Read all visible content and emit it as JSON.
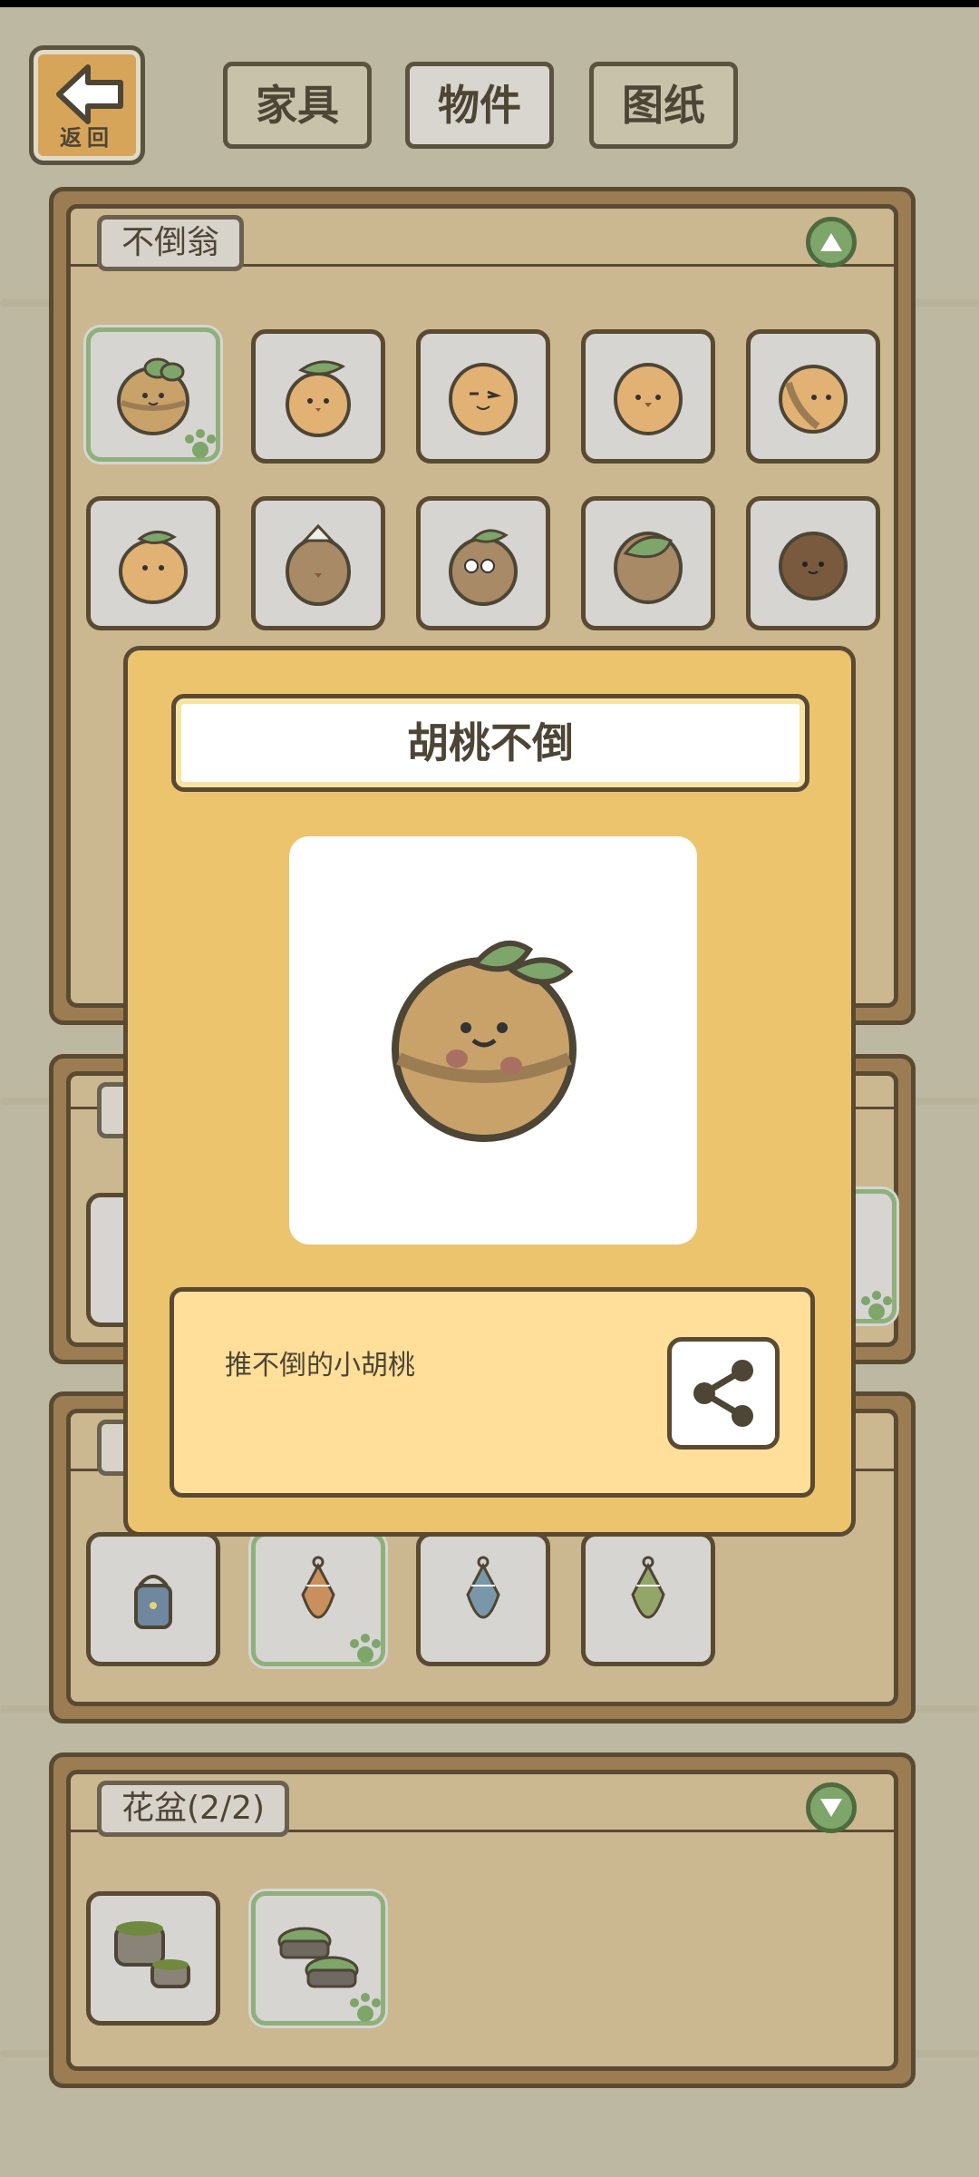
{
  "nav": {
    "back_label": "返回",
    "tabs": [
      {
        "label": "家具",
        "active": false
      },
      {
        "label": "物件",
        "active": true
      },
      {
        "label": "图纸",
        "active": false
      }
    ]
  },
  "categories": [
    {
      "label": "不倒翁",
      "toggle": "collapse"
    },
    {
      "label": "",
      "toggle": "none"
    },
    {
      "label": "",
      "toggle": "none"
    },
    {
      "label": "花盆(2/2)",
      "toggle": "expand"
    }
  ],
  "modal": {
    "title": "胡桃不倒",
    "description": "推不倒的小胡桃",
    "share_icon": "share-icon"
  },
  "colors": {
    "background": "#bdb8a1",
    "panel_frame": "#9c7d53",
    "panel_fill": "#cbb891",
    "modal_fill": "#ecc46e",
    "desc_fill": "#ffdf9a",
    "accent_green": "#7ea56a",
    "outline": "#5a4a32"
  }
}
